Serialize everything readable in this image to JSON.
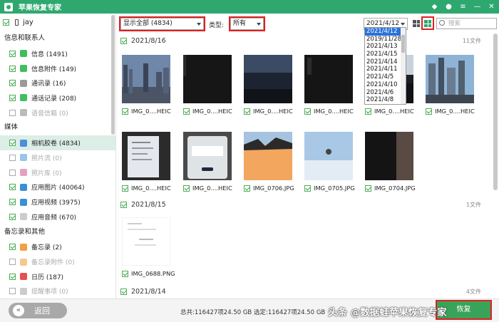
{
  "app": {
    "title": "苹果恢复专家"
  },
  "window_controls": [
    "diamond-icon",
    "chat-icon",
    "menu-icon",
    "minimize-icon",
    "close-icon"
  ],
  "sidebar": {
    "device": "jay",
    "sections": [
      {
        "title": "信息和联系人",
        "items": [
          {
            "label": "信息 (1491)",
            "checked": true,
            "dim": false,
            "color": "#3fbf5f"
          },
          {
            "label": "信息附件 (149)",
            "checked": true,
            "dim": false,
            "color": "#3fbf5f"
          },
          {
            "label": "通讯录 (16)",
            "checked": true,
            "dim": false,
            "color": "#9a9a9a"
          },
          {
            "label": "通话记录 (208)",
            "checked": true,
            "dim": false,
            "color": "#3fbf5f"
          },
          {
            "label": "语音信箱 (0)",
            "checked": false,
            "dim": true,
            "color": "#bbbbbb"
          }
        ]
      },
      {
        "title": "媒体",
        "items": [
          {
            "label": "相机胶卷 (4834)",
            "checked": true,
            "dim": false,
            "color": "#4a90d9",
            "active": true
          },
          {
            "label": "照片流 (0)",
            "checked": false,
            "dim": true,
            "color": "#9cc3ea"
          },
          {
            "label": "照片库 (0)",
            "checked": false,
            "dim": true,
            "color": "#e6a0c4"
          },
          {
            "label": "应用图片 (40064)",
            "checked": true,
            "dim": false,
            "color": "#3b8fd6"
          },
          {
            "label": "应用视频 (3975)",
            "checked": true,
            "dim": false,
            "color": "#3b8fd6"
          },
          {
            "label": "应用音频 (670)",
            "checked": true,
            "dim": false,
            "color": "#cccccc"
          }
        ]
      },
      {
        "title": "备忘录和其他",
        "items": [
          {
            "label": "备忘录 (2)",
            "checked": true,
            "dim": false,
            "color": "#f0a040"
          },
          {
            "label": "备忘录附件 (0)",
            "checked": false,
            "dim": true,
            "color": "#f5c890"
          },
          {
            "label": "日历 (187)",
            "checked": true,
            "dim": false,
            "color": "#e55050"
          },
          {
            "label": "提醒事项 (0)",
            "checked": false,
            "dim": true,
            "color": "#cccccc"
          }
        ]
      }
    ]
  },
  "toolbar": {
    "filter_value": "显示全部 (4834)",
    "type_label": "类型:",
    "type_value": "所有",
    "date_value": "2021/4/12",
    "search_placeholder": "搜索"
  },
  "date_options": [
    "2021/4/12",
    "2019/11/28",
    "2021/4/13",
    "2021/4/15",
    "2021/4/14",
    "2021/4/11",
    "2021/4/5",
    "2021/4/10",
    "2021/4/6",
    "2021/4/8"
  ],
  "groups": [
    {
      "date": "2021/8/16",
      "count": "11文件"
    },
    {
      "date": "2021/8/15",
      "count": "1文件"
    },
    {
      "date": "2021/8/14",
      "count": "4文件"
    }
  ],
  "thumbs": [
    {
      "name": "IMG_0....HEIC",
      "kind": "city"
    },
    {
      "name": "IMG_0....HEIC",
      "kind": "dark"
    },
    {
      "name": "IMG_0....HEIC",
      "kind": "night"
    },
    {
      "name": "IMG_0....HEIC",
      "kind": "dark2"
    },
    {
      "name": "IMG_0....HEIC",
      "kind": "city2"
    },
    {
      "name": "IMG_0....HEIC",
      "kind": "city3"
    },
    {
      "name": "IMG_0....HEIC",
      "kind": "paper"
    },
    {
      "name": "IMG_0....HEIC",
      "kind": "phone"
    },
    {
      "name": "IMG_0706.JPG",
      "kind": "sunset"
    },
    {
      "name": "IMG_0705.JPG",
      "kind": "sky"
    },
    {
      "name": "IMG_0704.JPG",
      "kind": "darkpaper"
    },
    {
      "name": "IMG_0688.PNG",
      "kind": "doc"
    }
  ],
  "status": {
    "back_label": "返回",
    "stats": "总共:116427项24.50 GB 选定:116427项24.50 GB",
    "watermark": "头条 @数据蛙苹果恢复专家",
    "recover_label": "恢复"
  }
}
